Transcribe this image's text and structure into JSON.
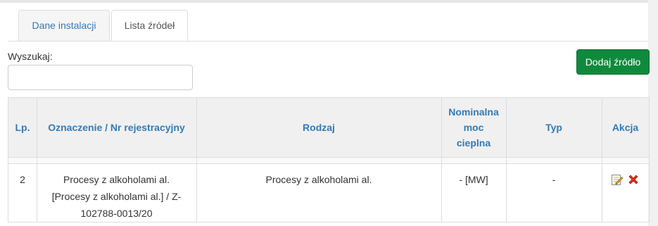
{
  "tabs": [
    {
      "label": "Dane instalacji",
      "active": false
    },
    {
      "label": "Lista źródeł",
      "active": true
    }
  ],
  "search": {
    "label": "Wyszukaj:",
    "value": ""
  },
  "add_button": {
    "label": "Dodaj źródło",
    "color": "#0f8a3c"
  },
  "table": {
    "headers": {
      "lp": "Lp.",
      "oznaczenie": "Oznaczenie / Nr rejestracyjny",
      "rodzaj": "Rodzaj",
      "moc_1": "Nominalna",
      "moc_2": "moc",
      "moc_3": "cieplna",
      "typ": "Typ",
      "akcja": "Akcja"
    },
    "rows": [
      {
        "lp": "2",
        "oznaczenie_1": "Procesy z alkoholami al.",
        "oznaczenie_2": "[Procesy z alkoholami al.] / Z-",
        "oznaczenie_3": "102788-0013/20",
        "rodzaj": "Procesy z alkoholami al.",
        "moc": "- [MW]",
        "typ": "-",
        "actions": {
          "edit": "edit-icon",
          "delete": "delete-icon"
        }
      }
    ]
  },
  "colors": {
    "link": "#337ab7",
    "delete": "#d9341e",
    "header_bg": "#f0f0f0"
  }
}
